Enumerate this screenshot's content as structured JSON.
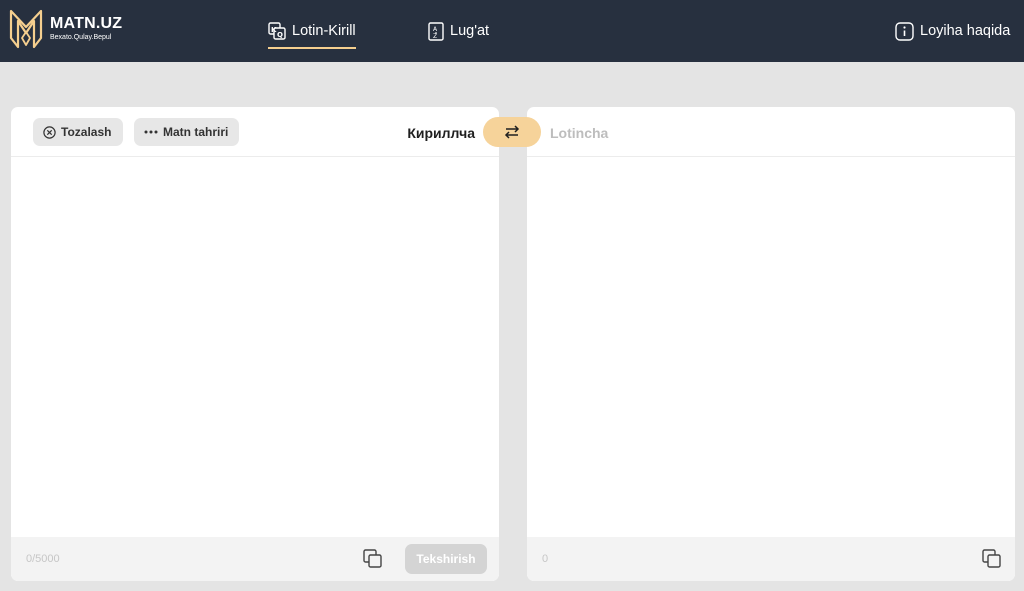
{
  "header": {
    "logo_text": "MATN.UZ",
    "logo_tagline": "Bexato.Qulay.Bepul",
    "nav": {
      "lotin_kirill": "Lotin-Kirill",
      "lugat": "Lug'at",
      "about": "Loyiha haqida"
    },
    "accent_color": "#f5cf8f",
    "background_color": "#27303f"
  },
  "left_panel": {
    "clear_button": "Tozalash",
    "edit_button": "Matn tahriri",
    "source_language": "Кириллча",
    "char_counter": "0/5000",
    "check_button": "Tekshirish"
  },
  "swap_button": {
    "icon": "swap-arrows-icon",
    "color": "#f6d39a"
  },
  "right_panel": {
    "target_language": "Lotincha",
    "char_counter": "0"
  }
}
